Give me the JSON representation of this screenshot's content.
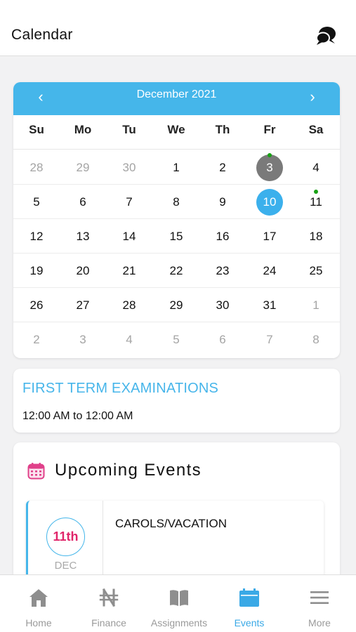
{
  "header": {
    "title": "Calendar",
    "chat_icon": "chat-bubbles-icon"
  },
  "calendar": {
    "month_label": "December 2021",
    "prev_label": "‹",
    "next_label": "›",
    "weekdays": [
      "Su",
      "Mo",
      "Tu",
      "We",
      "Th",
      "Fr",
      "Sa"
    ],
    "weeks": [
      [
        "28",
        "29",
        "30",
        "1",
        "2",
        "3",
        "4"
      ],
      [
        "5",
        "6",
        "7",
        "8",
        "9",
        "10",
        "11"
      ],
      [
        "12",
        "13",
        "14",
        "15",
        "16",
        "17",
        "18"
      ],
      [
        "19",
        "20",
        "21",
        "22",
        "23",
        "24",
        "25"
      ],
      [
        "26",
        "27",
        "28",
        "29",
        "30",
        "31",
        "1"
      ],
      [
        "2",
        "3",
        "4",
        "5",
        "6",
        "7",
        "8"
      ]
    ],
    "accent_color": "#45b6ea",
    "event_dot_color": "#17a114"
  },
  "exam": {
    "title": "FIRST TERM EXAMINATIONS",
    "time": "12:00 AM to 12:00 AM"
  },
  "upcoming": {
    "title": "Upcoming Events",
    "icon": "calendar-icon",
    "events": [
      {
        "day": "11th",
        "month": "DEC",
        "name": "CAROLS/VACATION"
      }
    ]
  },
  "tabs": [
    {
      "label": "Home",
      "icon": "home-icon",
      "active": false
    },
    {
      "label": "Finance",
      "icon": "naira-icon",
      "active": false
    },
    {
      "label": "Assignments",
      "icon": "book-icon",
      "active": false
    },
    {
      "label": "Events",
      "icon": "calendar-icon",
      "active": true
    },
    {
      "label": "More",
      "icon": "menu-icon",
      "active": false
    }
  ]
}
